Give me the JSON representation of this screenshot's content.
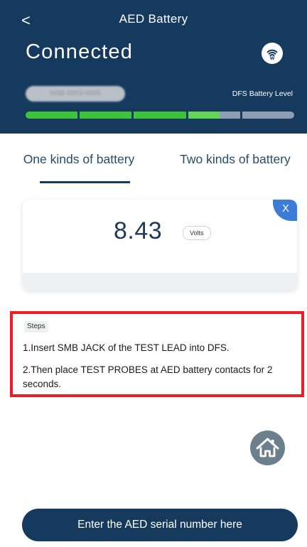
{
  "header": {
    "back_glyph": "<",
    "title": "AED Battery",
    "status": "Connected",
    "wifi_icon": "wifi-icon",
    "serial_number_blurred": "NSB-0003-0006",
    "battery_level_label": "DFS Battery Level",
    "battery_level_fraction": 0.72,
    "battery_segments": 5,
    "colors": {
      "background": "#153a5d",
      "level_filled": "#3ec43a",
      "level_partial": "#64d655",
      "level_empty": "#8e9fb4"
    }
  },
  "tabs": [
    {
      "label": "One kinds of battery",
      "active": true
    },
    {
      "label": "Two kinds of battery",
      "active": false
    }
  ],
  "measurement": {
    "value": "8.43",
    "unit": "Volts",
    "close_label": "X"
  },
  "steps": {
    "tag": "Steps",
    "items": [
      "1.Insert SMB JACK of the TEST LEAD into DFS.",
      "2.Then place TEST PROBES at AED battery contacts for 2 seconds."
    ]
  },
  "home_icon": "home-icon",
  "serial_button": {
    "label": "Enter the AED serial number here"
  }
}
